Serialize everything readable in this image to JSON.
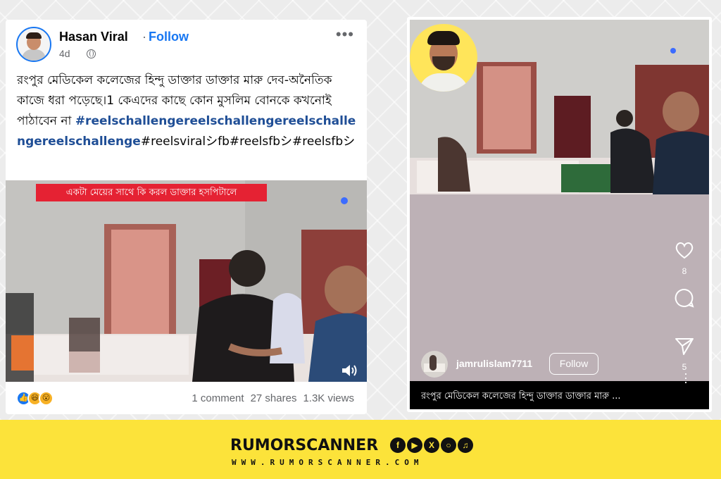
{
  "facebook_post": {
    "author": "Hasan Viral",
    "separator": "·",
    "follow_label": "Follow",
    "time": "4d",
    "more_icon": "ellipsis-icon",
    "text_main": "রংপুর মেডিকেল কলেজের হিন্দু ডাক্তার ডাক্তার মারু দেব-অনৈতিক কাজে ধরা পড়েছে।1 কেএদের কাছে কোন মুসলিম বোনকে কখনোই পাঠাবেন না",
    "hashtags_bold": "#reelschallengereelschallengereelschallengereelschallenge",
    "hashtags_rest": "#reelsviralシfb#reelsfbシ#reelsfbシ",
    "video_caption": "একটা মেয়ের সাথে কি করল ডাক্তার হসপিটালে",
    "reactions": [
      "like-icon",
      "haha-icon",
      "wow-icon"
    ],
    "comments": "1 comment",
    "shares": "27 shares",
    "views": "1.3K views"
  },
  "instagram_reel": {
    "likes": "8",
    "shares": "5",
    "username": "jamrulislam7711",
    "follow_label": "Follow",
    "caption": "রংপুর মেডিকেল কলেজের হিন্দু ডাক্তার ডাক্তার মারু ..."
  },
  "footer": {
    "brand": "RUMORSCANNER",
    "website": "WWW.RUMORSCANNER.COM",
    "socials": [
      "facebook-icon",
      "youtube-icon",
      "x-icon",
      "instagram-icon",
      "tiktok-icon"
    ]
  },
  "colors": {
    "facebook_blue": "#1877f2",
    "hashtag_blue": "#1f4e96",
    "caption_red": "#e52233",
    "footer_yellow": "#fce33a"
  }
}
